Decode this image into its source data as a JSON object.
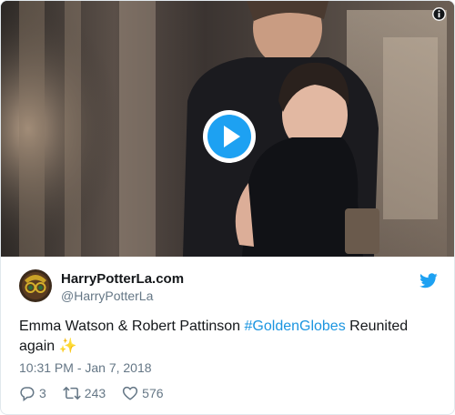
{
  "tweet": {
    "display_name": "HarryPotterLa.com",
    "handle": "@HarryPotterLa",
    "text_before": "Emma Watson & Robert Pattinson ",
    "hashtag": "#GoldenGlobes",
    "text_after": " Reunited again ✨",
    "date": "10:31 PM - Jan 7, 2018"
  },
  "actions": {
    "replies": "3",
    "retweets": "243",
    "likes": "576"
  },
  "icons": {
    "media_info": "info-icon",
    "play": "play-icon",
    "brand": "twitter-bird-icon",
    "reply": "reply-icon",
    "retweet": "retweet-icon",
    "like": "heart-icon"
  },
  "colors": {
    "brand": "#1da1f2",
    "hashtag": "#1b95e0",
    "secondary_text": "#657786",
    "play_button": "#1da1f2"
  }
}
